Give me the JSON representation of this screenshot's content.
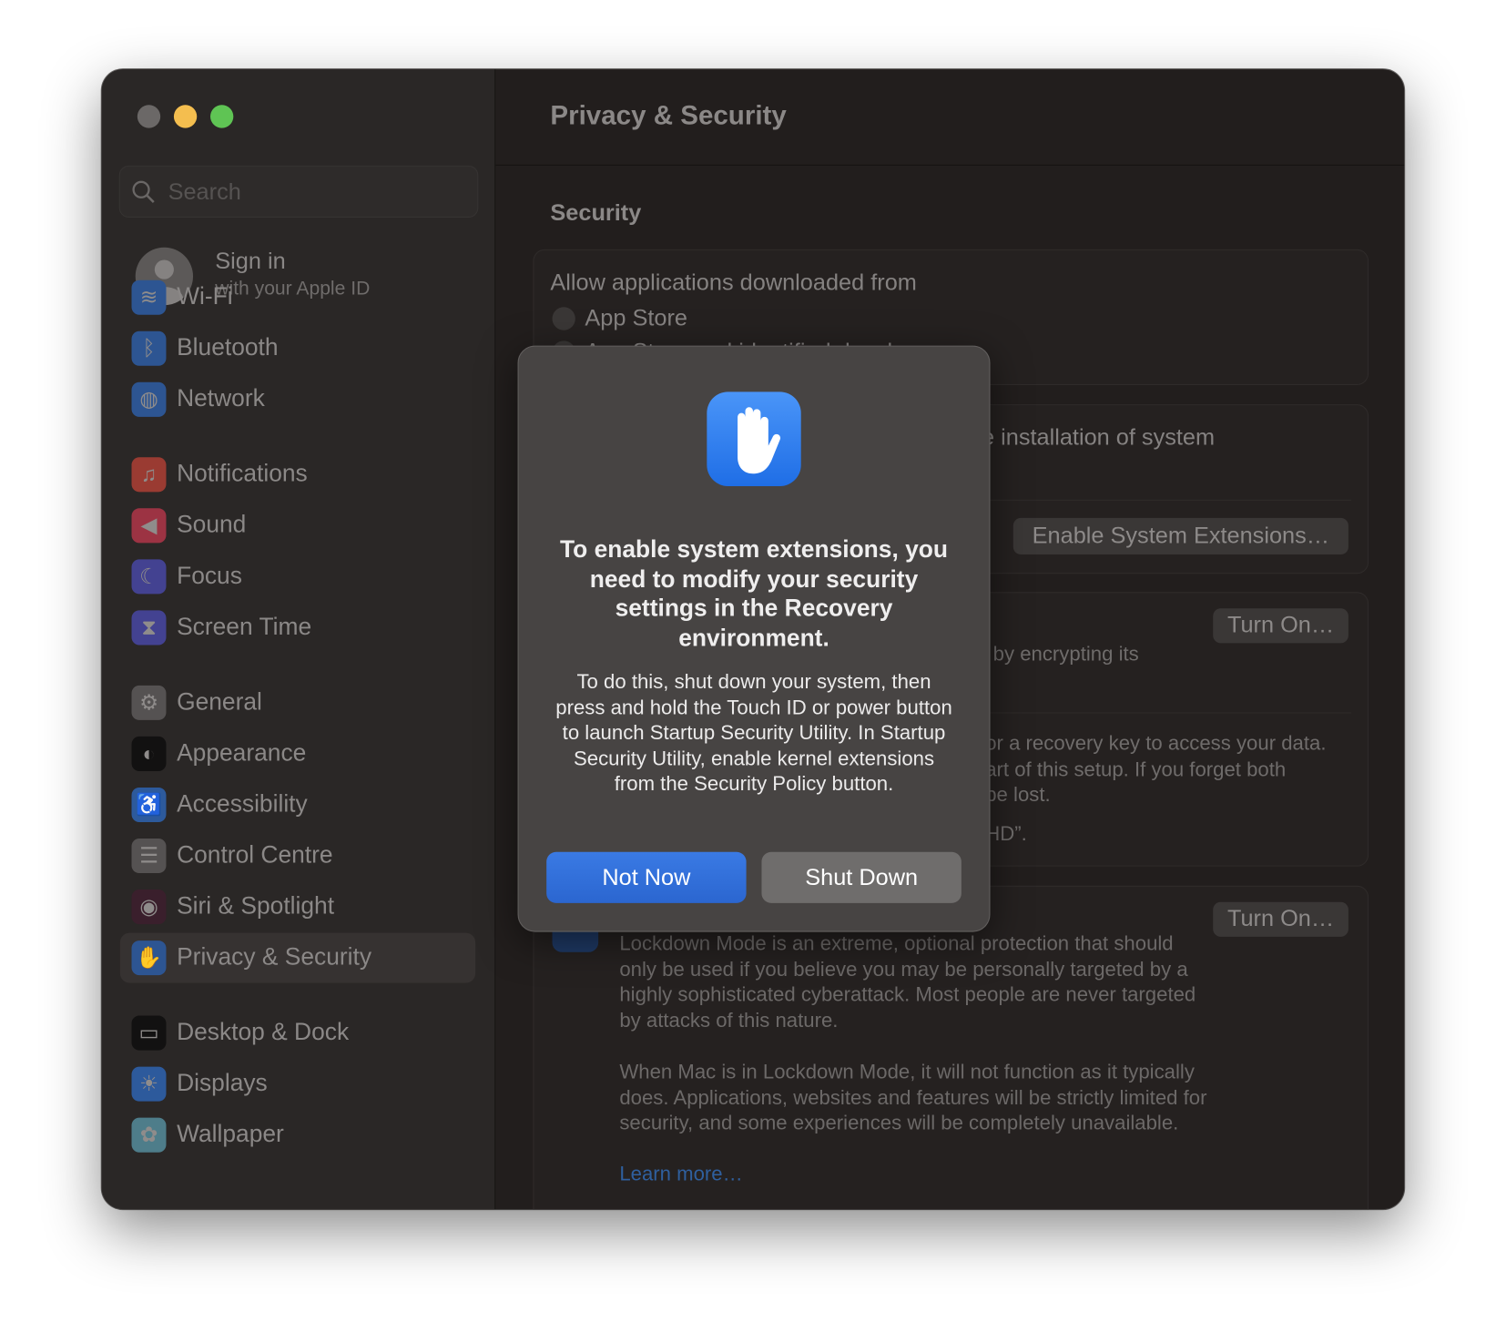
{
  "window": {
    "traffic_lights": {
      "close": "#6b6867",
      "minimize": "#f4be4f",
      "zoom": "#5fc454"
    }
  },
  "sidebar": {
    "search_placeholder": "Search",
    "account": {
      "title": "Sign in",
      "subtitle": "with your Apple ID"
    },
    "selected": "Privacy & Security",
    "items": [
      {
        "label": "Wi-Fi",
        "icon": "wifi-icon",
        "color": "#2d5592"
      },
      {
        "label": "Bluetooth",
        "icon": "bluetooth-icon",
        "color": "#2d5592"
      },
      {
        "label": "Network",
        "icon": "globe-icon",
        "color": "#2d5592"
      },
      {
        "label": "Notifications",
        "icon": "bell-icon",
        "color": "#9a3b32"
      },
      {
        "label": "Sound",
        "icon": "speaker-icon",
        "color": "#9c3343"
      },
      {
        "label": "Focus",
        "icon": "moon-icon",
        "color": "#434291"
      },
      {
        "label": "Screen Time",
        "icon": "hourglass-icon",
        "color": "#434291"
      },
      {
        "label": "General",
        "icon": "gear-icon",
        "color": "#555252"
      },
      {
        "label": "Appearance",
        "icon": "appearance-icon",
        "color": "#121111"
      },
      {
        "label": "Accessibility",
        "icon": "accessibility-icon",
        "color": "#2d5a9c"
      },
      {
        "label": "Control Centre",
        "icon": "toggles-icon",
        "color": "#555252"
      },
      {
        "label": "Siri & Spotlight",
        "icon": "siri-icon",
        "color": "#3a1f2c"
      },
      {
        "label": "Privacy & Security",
        "icon": "hand-icon",
        "color": "#2d5592"
      },
      {
        "label": "Desktop & Dock",
        "icon": "dock-icon",
        "color": "#121111"
      },
      {
        "label": "Displays",
        "icon": "sun-icon",
        "color": "#2d5a9c"
      },
      {
        "label": "Wallpaper",
        "icon": "flower-icon",
        "color": "#4e7d8a"
      }
    ]
  },
  "main": {
    "title": "Privacy & Security",
    "section": "Security",
    "allow_apps": {
      "label": "Allow applications downloaded from",
      "options": [
        "App Store",
        "App Store and identified developers"
      ]
    },
    "extensions": {
      "text": "the installation of system",
      "button": "Enable System Extensions…"
    },
    "filevault": {
      "button": "Turn On…",
      "text": "by encrypting its",
      "lines": [
        "or a recovery key to access your data.",
        "art of this setup. If you forget both",
        "be lost.",
        "HD”."
      ]
    },
    "lockdown": {
      "button": "Turn On…",
      "paragraph1": "Lockdown Mode is an extreme, optional protection that should only be used if you believe you may be personally targeted by a highly sophisticated cyberattack. Most people are never targeted by attacks of this nature.",
      "paragraph2": "When Mac is in Lockdown Mode, it will not function as it typically does. Applications, websites and features will be strictly limited for security, and some experiences will be completely unavailable.",
      "link": "Learn more…",
      "link_color": "#2f5f9e"
    }
  },
  "dialog": {
    "icon": "hand-icon",
    "title": "To enable system extensions, you need to modify your security settings in the Recovery environment.",
    "body": "To do this, shut down your system, then press and hold the Touch ID or power button to launch Startup Security Utility. In Startup Security Utility, enable kernel extensions from the Security Policy button.",
    "primary_button": "Not Now",
    "secondary_button": "Shut Down",
    "accent": "#2f6fdc"
  }
}
